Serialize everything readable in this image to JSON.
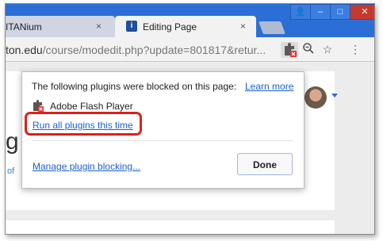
{
  "tabs": [
    {
      "label": "ITANium",
      "close": "×"
    },
    {
      "label": "Editing Page",
      "close": "×"
    }
  ],
  "window_controls": {
    "user": "👤",
    "minimize": "–",
    "maximize": "□",
    "close": "✕"
  },
  "address_bar": {
    "domain": "ton.edu",
    "path": "/course/modedit.php?update=801817&retur..."
  },
  "toolbar_icons": [
    "puzzle-blocked-icon",
    "zoom-icon",
    "star-icon",
    "menu-icon"
  ],
  "page": {
    "heading_fragment": "g",
    "link_fragment": "of"
  },
  "popup": {
    "heading": "The following plugins were blocked on this page:",
    "learn_more": "Learn more",
    "plugin_name": "Adobe Flash Player",
    "run_all": "Run all plugins this time",
    "manage": "Manage plugin blocking...",
    "done": "Done"
  },
  "colors": {
    "accent": "#2b6fd6",
    "link": "#1a5fcf",
    "highlight": "#d8231b"
  }
}
